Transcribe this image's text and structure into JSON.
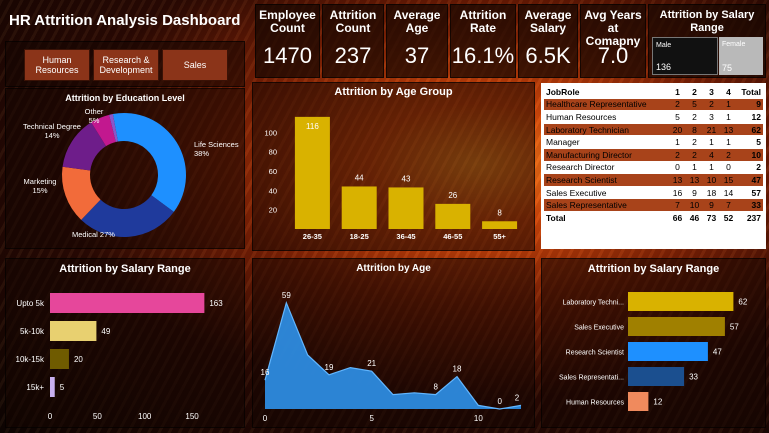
{
  "title": "HR Attrition Analysis Dashboard",
  "buttons": [
    "Human Resources",
    "Research & Development",
    "Sales"
  ],
  "kpis": [
    {
      "label": "Employee Count",
      "value": "1470"
    },
    {
      "label": "Attrition Count",
      "value": "237"
    },
    {
      "label": "Average Age",
      "value": "37"
    },
    {
      "label": "Attrition Rate",
      "value": "16.1%"
    },
    {
      "label": "Average Salary",
      "value": "6.5K"
    },
    {
      "label": "Avg Years at Comapny",
      "value": "7.0"
    }
  ],
  "gender_card": {
    "title": "Attrition by Salary Range",
    "male_label": "Male",
    "male_value": "136",
    "female_label": "Female",
    "female_value": "75"
  },
  "colors": {
    "blue": "#1e90ff",
    "navy": "#1f3a9c",
    "orange": "#f26b3a",
    "purple": "#6e1d8a",
    "magenta": "#c2188f",
    "violet": "#8a56c9",
    "gold": "#d9b200",
    "pink": "#e6479b",
    "sand": "#e8d070",
    "olive": "#6f5b00",
    "lavender": "#c8b0f0",
    "dark_gold": "#a08000",
    "dark_blue": "#1b4f8f",
    "salmon": "#f08a5d",
    "age_blue": "#2e8fe6"
  },
  "chart_data": [
    {
      "type": "pie",
      "title": "Attrition by Education Level",
      "categories": [
        "Life Sciences",
        "Medical",
        "Marketing",
        "Technical Degree",
        "Other",
        "Human Resources"
      ],
      "labels": [
        "Life Sciences\n38%",
        "Medical 27%",
        "Marketing\n15%",
        "Technical Degree\n14%",
        "Other\n5%",
        ""
      ],
      "values": [
        38,
        27,
        15,
        14,
        5,
        1
      ],
      "colors": [
        "#1e90ff",
        "#1f3a9c",
        "#f26b3a",
        "#6e1d8a",
        "#c2188f",
        "#8a56c9"
      ]
    },
    {
      "type": "bar",
      "title": "Attrition by Age Group",
      "categories": [
        "26-35",
        "18-25",
        "36-45",
        "46-55",
        "55+"
      ],
      "values": [
        116,
        44,
        43,
        26,
        8
      ],
      "yticks": [
        20,
        40,
        60,
        80,
        100
      ],
      "ylim": [
        0,
        120
      ],
      "color": "#d9b200"
    },
    {
      "type": "table",
      "columns": [
        "JobRole",
        "1",
        "2",
        "3",
        "4",
        "Total"
      ],
      "rows": [
        [
          "Healthcare Representative",
          "2",
          "5",
          "2",
          "1",
          "4",
          "9"
        ],
        [
          "Human Resources",
          "5",
          "2",
          "3",
          "1",
          "2",
          "12"
        ],
        [
          "Laboratory Technician",
          "20",
          "8",
          "21",
          "13",
          "",
          "62"
        ],
        [
          "Manager",
          "1",
          "2",
          "1",
          "1",
          "",
          "5"
        ],
        [
          "Manufacturing Director",
          "2",
          "2",
          "4",
          "2",
          "",
          "10"
        ],
        [
          "Research Director",
          "0",
          "1",
          "1",
          "0",
          "",
          "2"
        ],
        [
          "Research Scientist",
          "13",
          "13",
          "10",
          "15",
          "9",
          "47"
        ],
        [
          "Sales Executive",
          "16",
          "9",
          "18",
          "14",
          "",
          "57"
        ],
        [
          "Sales Representative",
          "7",
          "10",
          "9",
          "7",
          "",
          "33"
        ]
      ],
      "total": [
        "Total",
        "66",
        "46",
        "73",
        "52",
        "237"
      ]
    },
    {
      "type": "bar",
      "orientation": "horizontal",
      "title": "Attrition by Salary Range",
      "categories": [
        "Upto 5k",
        "5k-10k",
        "10k-15k",
        "15k+"
      ],
      "values": [
        163,
        49,
        20,
        5
      ],
      "xticks": [
        0,
        50,
        100,
        150
      ],
      "xlim": [
        0,
        170
      ],
      "colors": [
        "#e6479b",
        "#e8d070",
        "#6f5b00",
        "#c8b0f0"
      ]
    },
    {
      "type": "area",
      "title": "Attrition by Age",
      "x": [
        0,
        1,
        2,
        3,
        4,
        5,
        6,
        7,
        8,
        9,
        10,
        11,
        12
      ],
      "values": [
        16,
        59,
        30,
        19,
        23,
        21,
        8,
        9,
        8,
        18,
        2,
        0,
        2
      ],
      "point_labels": [
        [
          0,
          "16"
        ],
        [
          1,
          "59"
        ],
        [
          3,
          "19"
        ],
        [
          5,
          "21"
        ],
        [
          8,
          "8"
        ],
        [
          9,
          "18"
        ],
        [
          11,
          "0"
        ],
        [
          12,
          "2"
        ]
      ],
      "xticks": [
        0,
        5,
        10
      ],
      "ylim": [
        0,
        70
      ],
      "color": "#2e8fe6"
    },
    {
      "type": "bar",
      "orientation": "horizontal",
      "title": "Attrition by Salary Range",
      "categories": [
        "Laboratory Techni...",
        "Sales Executive",
        "Research Scientist",
        "Sales Representati...",
        "Human Resources"
      ],
      "values": [
        62,
        57,
        47,
        33,
        12
      ],
      "xlim": [
        0,
        70
      ],
      "colors": [
        "#d9b200",
        "#a08000",
        "#1e90ff",
        "#1b4f8f",
        "#f08a5d"
      ]
    }
  ]
}
